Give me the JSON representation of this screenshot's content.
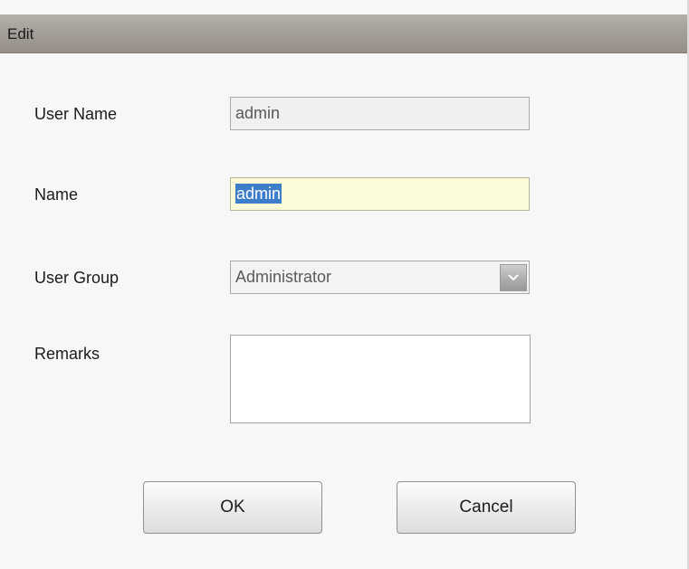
{
  "dialog": {
    "title": "Edit"
  },
  "form": {
    "user_name_label": "User Name",
    "user_name_value": "admin",
    "name_label": "Name",
    "name_value": "admin",
    "user_group_label": "User Group",
    "user_group_value": "Administrator",
    "remarks_label": "Remarks",
    "remarks_value": ""
  },
  "buttons": {
    "ok_label": "OK",
    "cancel_label": "Cancel"
  },
  "icons": {
    "dropdown": "chevron-down-icon"
  },
  "colors": {
    "titlebar": "#a49f98",
    "name_field_bg": "#fcfbd7",
    "selection": "#3d7ecb"
  }
}
